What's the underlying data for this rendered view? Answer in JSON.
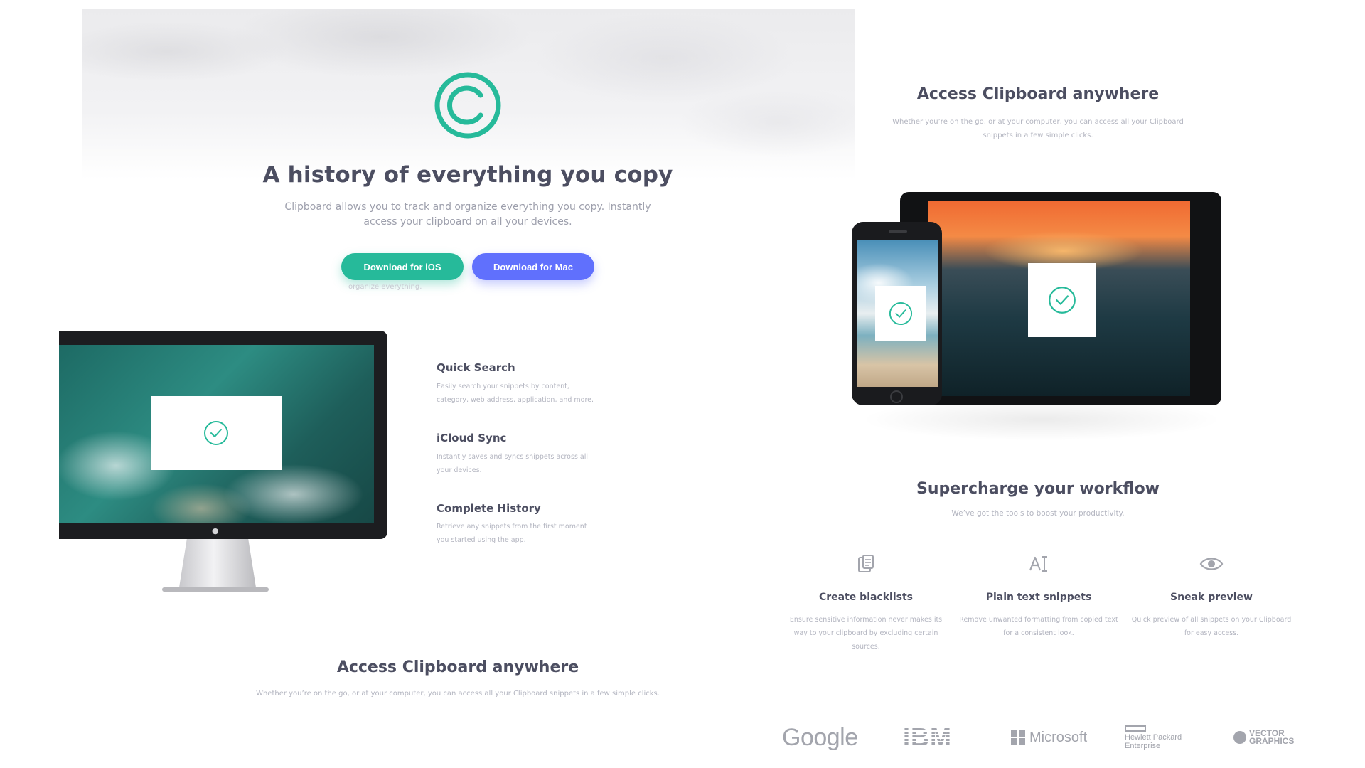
{
  "hero": {
    "title": "A history of everything you copy",
    "text": "Clipboard allows you to track and organize everything you copy. Instantly access your clipboard on all your devices.",
    "btn_ios": "Download for iOS",
    "btn_mac": "Download for Mac",
    "ghost_text": "organize everything."
  },
  "features": [
    {
      "title": "Quick Search",
      "text": "Easily search your snippets by content, category, web address, application, and more."
    },
    {
      "title": "iCloud Sync",
      "text": "Instantly saves and syncs snippets across all your devices."
    },
    {
      "title": "Complete History",
      "text": "Retrieve any snippets from the first moment you started using the app."
    }
  ],
  "access": {
    "title": "Access Clipboard anywhere",
    "text": "Whether you’re on the go, or at your computer, you can access all your Clipboard snippets in a few simple clicks."
  },
  "workflow": {
    "title": "Supercharge your workflow",
    "text": "We’ve got the tools to boost your productivity.",
    "items": [
      {
        "title": "Create blacklists",
        "text": "Ensure sensitive information never makes its way to your clipboard by excluding certain sources.",
        "icon": "blacklist-icon"
      },
      {
        "title": "Plain text snippets",
        "text": "Remove unwanted formatting from copied text for a consistent look.",
        "icon": "text-icon"
      },
      {
        "title": "Sneak preview",
        "text": "Quick preview of all snippets on your Clipboard for easy access.",
        "icon": "eye-icon"
      }
    ]
  },
  "partners": {
    "google": "Google",
    "ibm": "IBM",
    "microsoft": "Microsoft",
    "hp_line1": "Hewlett Packard",
    "hp_line2": "Enterprise",
    "vg_line1": "VECTOR",
    "vg_line2": "GRAPHICS"
  },
  "colors": {
    "accent_teal": "#26ba9a",
    "accent_blue": "#6070fd",
    "heading": "#4c4e61",
    "muted": "#b3b5c0"
  }
}
